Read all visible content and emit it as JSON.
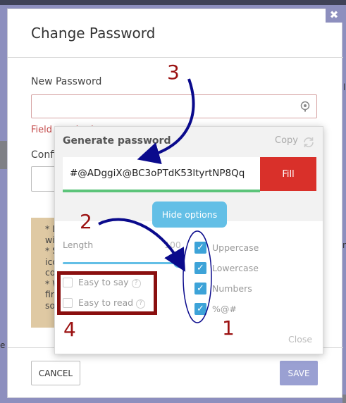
{
  "background": {
    "right_text_1": "l",
    "right_text_2": "n",
    "left_text": "e"
  },
  "modal": {
    "title": "Change Password",
    "close_glyph": "✖",
    "new_password_label": "New Password",
    "field_error": "Field required",
    "confirm_label": "Confi",
    "hint_lines": [
      "* L",
      "wi",
      "* S",
      "ico",
      "co",
      "* W",
      "fir",
      "so"
    ],
    "cancel_label": "CANCEL",
    "save_label": "SAVE"
  },
  "generator": {
    "title": "Generate password",
    "copy_label": "Copy",
    "generated_value": "#@ADggiX@BC3oPTdK53ltyrtNP8Qq",
    "fill_label": "Fill",
    "hide_options_label": "Hide options",
    "length_label": "Length",
    "length_value": "100",
    "length_fraction": 1.0,
    "char_options": [
      {
        "label": "Uppercase",
        "checked": true
      },
      {
        "label": "Lowercase",
        "checked": true
      },
      {
        "label": "Numbers",
        "checked": true
      },
      {
        "label": "%@#",
        "checked": true
      }
    ],
    "extra_options": [
      {
        "label": "Easy to say",
        "checked": false
      },
      {
        "label": "Easy to read",
        "checked": false
      }
    ],
    "close_label": "Close",
    "help_glyph": "?"
  },
  "annotations": {
    "n1": "1",
    "n2": "2",
    "n3": "3",
    "n4": "4",
    "color": "#9b1111",
    "arrow_color": "#0a0a8c"
  },
  "colors": {
    "accent_blue": "#63bfe6",
    "fill_red": "#d9302a",
    "save_purple": "#9aa0d2",
    "strength_green": "#5cc47a"
  }
}
